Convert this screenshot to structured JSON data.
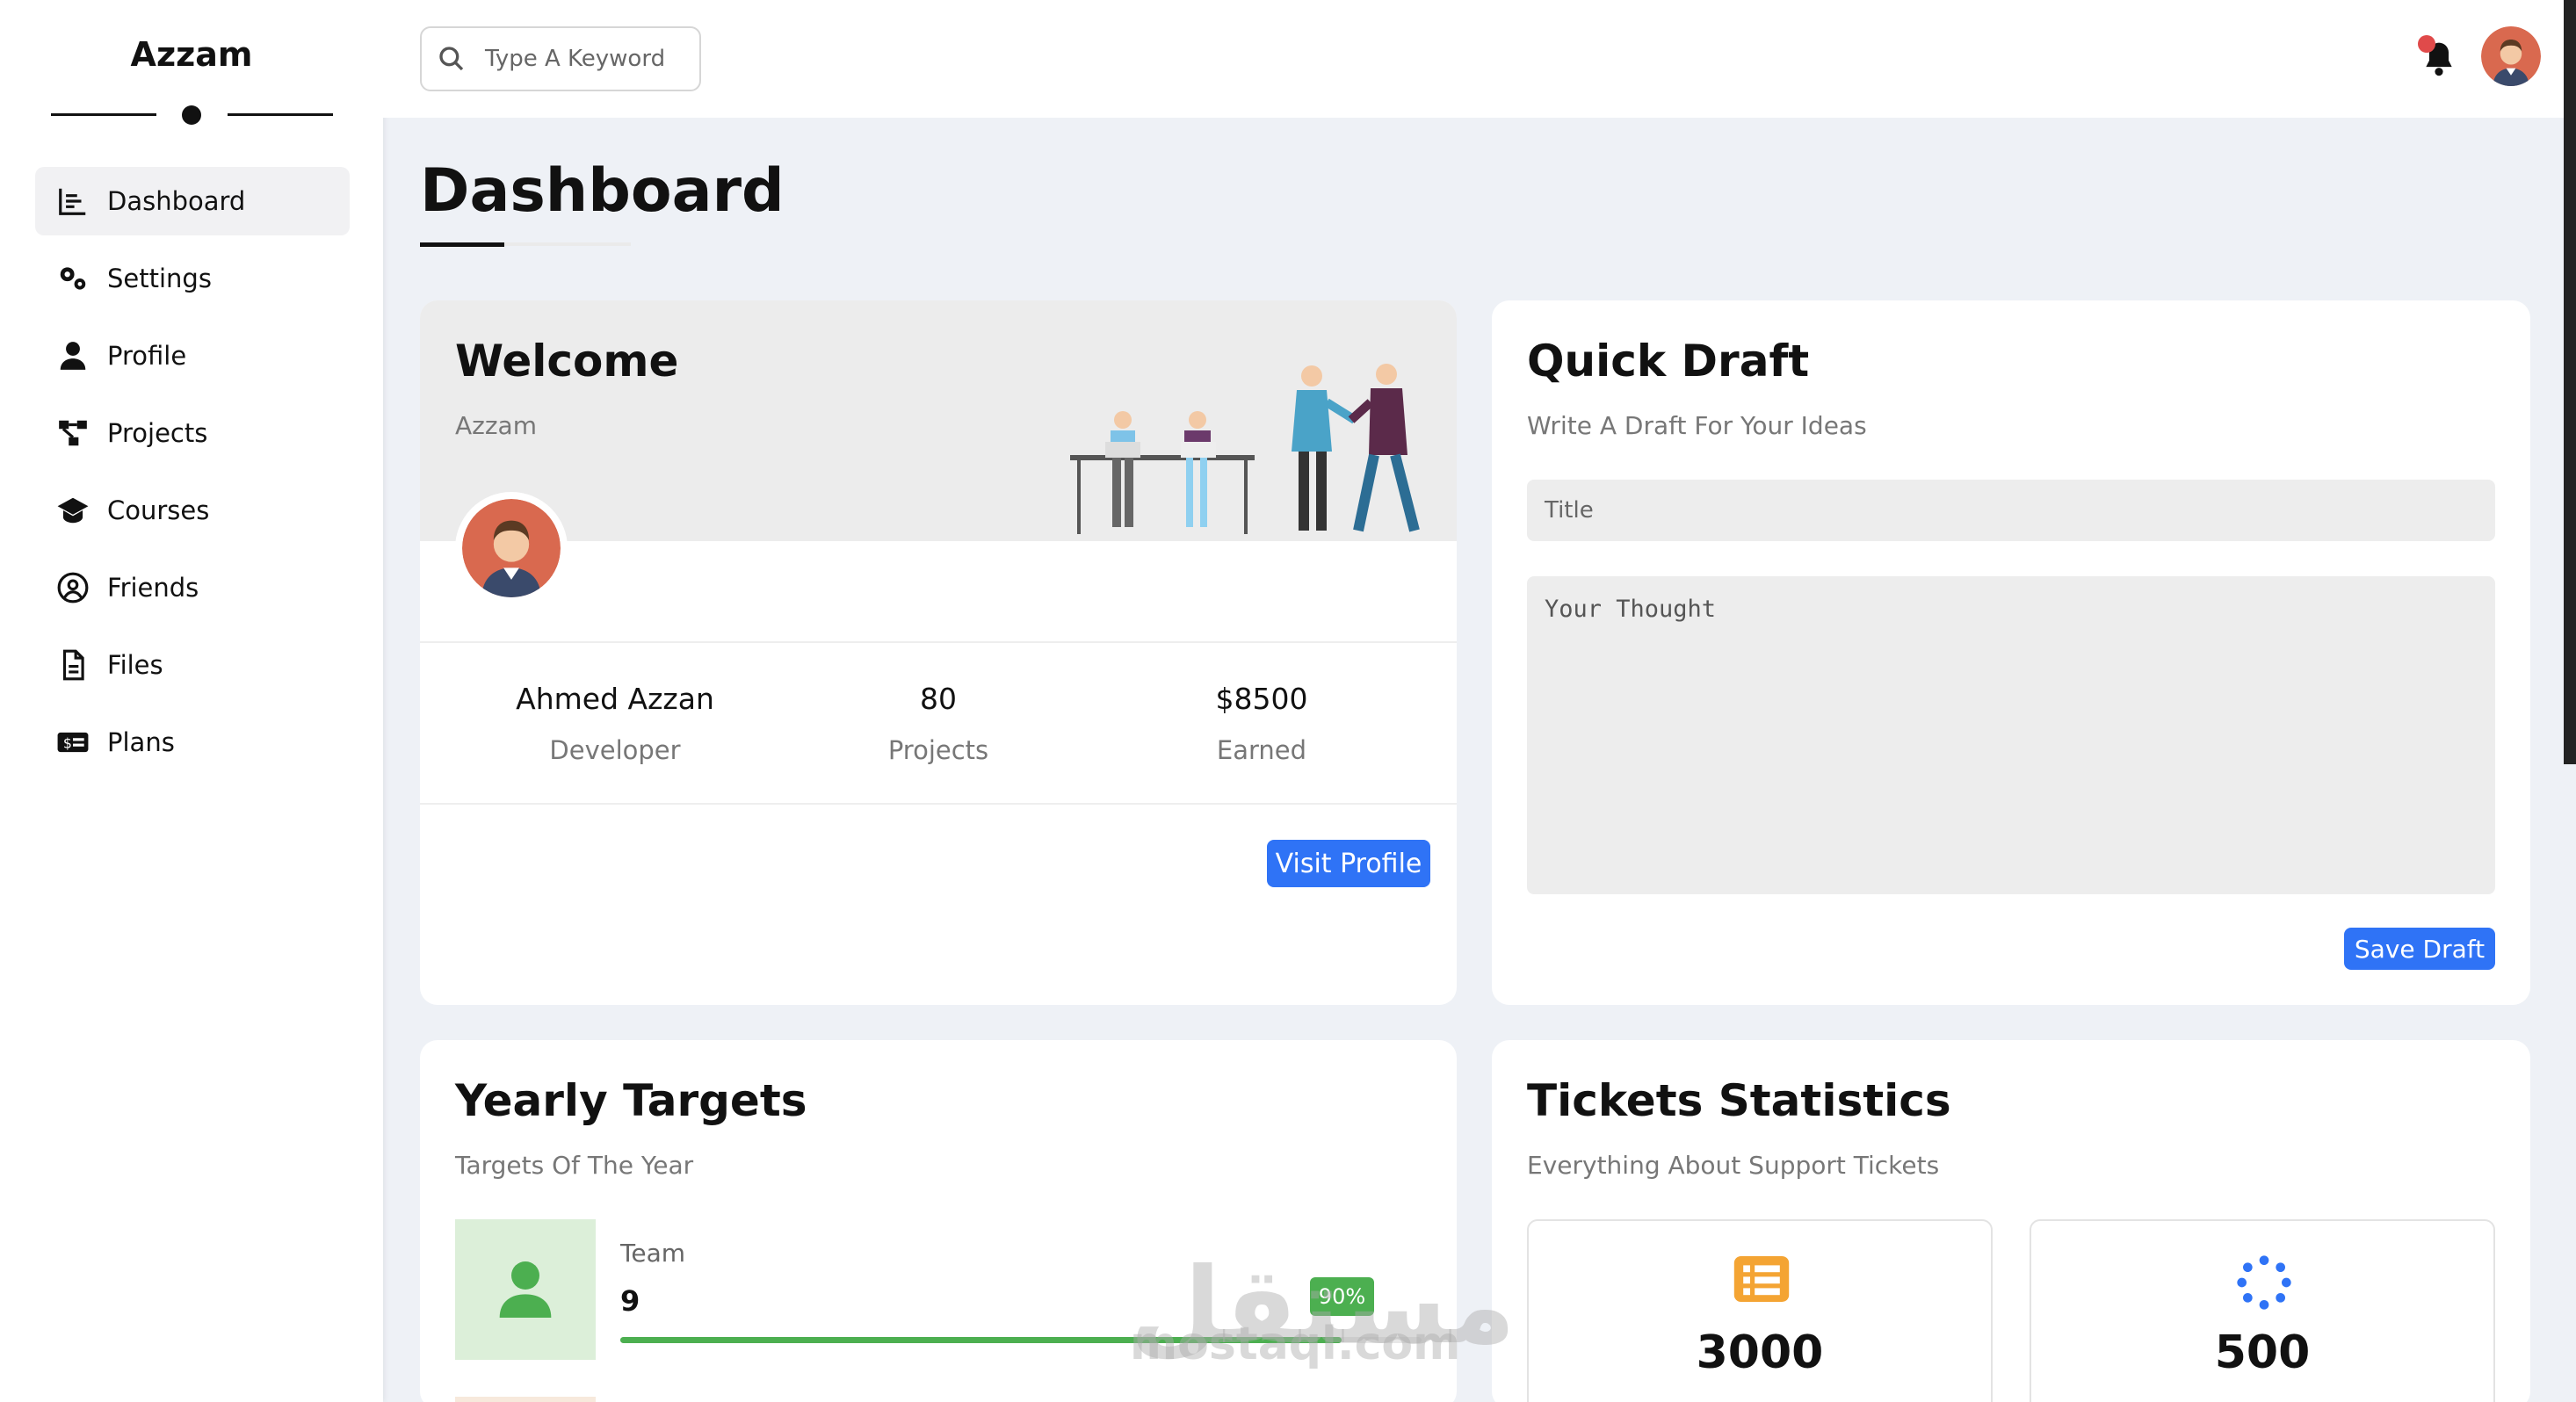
{
  "sidebar": {
    "brand": "Azzam",
    "items": [
      {
        "label": "Dashboard",
        "icon": "chart-icon",
        "active": true
      },
      {
        "label": "Settings",
        "icon": "gears-icon"
      },
      {
        "label": "Profile",
        "icon": "user-icon"
      },
      {
        "label": "Projects",
        "icon": "diagram-icon"
      },
      {
        "label": "Courses",
        "icon": "graduation-cap-icon"
      },
      {
        "label": "Friends",
        "icon": "user-circle-icon"
      },
      {
        "label": "Files",
        "icon": "file-icon"
      },
      {
        "label": "Plans",
        "icon": "money-icon"
      }
    ]
  },
  "header": {
    "search_placeholder": "Type A Keyword"
  },
  "page": {
    "title": "Dashboard"
  },
  "welcome": {
    "title": "Welcome",
    "subtitle": "Azzam",
    "stats": [
      {
        "value": "Ahmed Azzan",
        "label": "Developer"
      },
      {
        "value": "80",
        "label": "Projects"
      },
      {
        "value": "$8500",
        "label": "Earned"
      }
    ],
    "button": "Visit Profile"
  },
  "draft": {
    "title": "Quick Draft",
    "subtitle": "Write A Draft For Your Ideas",
    "title_placeholder": "Title",
    "body_placeholder": "Your Thought",
    "button": "Save Draft"
  },
  "targets": {
    "title": "Yearly Targets",
    "subtitle": "Targets Of The Year",
    "items": [
      {
        "name": "Team",
        "value": "9",
        "progress": "90%",
        "progress_fraction": 0.9
      }
    ]
  },
  "tickets": {
    "title": "Tickets Statistics",
    "subtitle": "Everything About Support Tickets",
    "items": [
      {
        "value": "3000",
        "icon": "list-icon"
      },
      {
        "value": "500",
        "icon": "spinner-icon"
      }
    ]
  },
  "watermark": {
    "text": "مستقل",
    "sub": "mostaql.com"
  },
  "colors": {
    "accent": "#2f73f6",
    "success": "#4caf50",
    "notification": "#e04a4a"
  }
}
